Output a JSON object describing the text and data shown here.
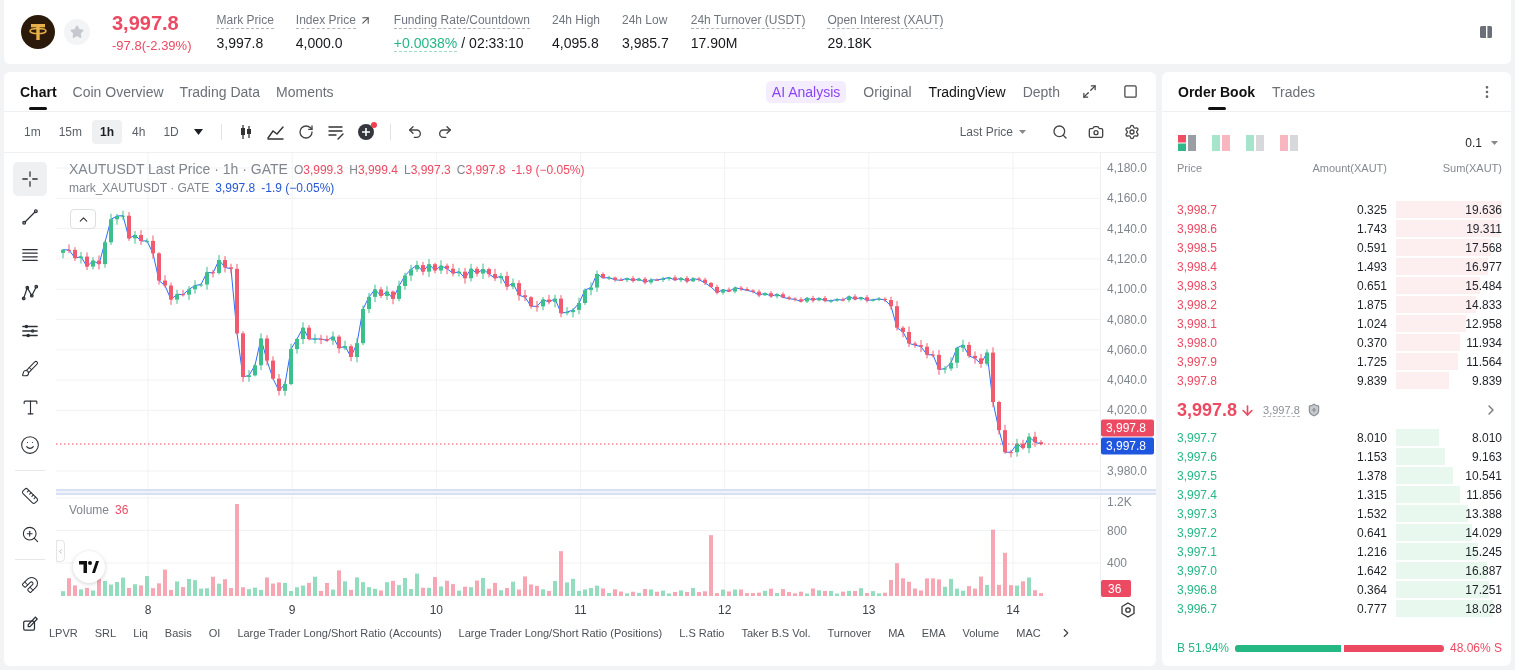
{
  "header": {
    "price": "3,997.8",
    "change": "-97.8(-2.39%)",
    "falling": true,
    "starred": false,
    "stats": [
      {
        "label": "Mark Price",
        "value": "3,997.8",
        "dotted": true,
        "link": false,
        "positive": false
      },
      {
        "label": "Index Price",
        "value": "4,000.0",
        "dotted": true,
        "link": true,
        "positive": false
      },
      {
        "label": "Funding Rate/Countdown",
        "value": "+0.0038%",
        "extra": "/ 02:33:10",
        "dotted": true,
        "link": false,
        "positive": true
      },
      {
        "label": "24h High",
        "value": "4,095.8",
        "dotted": false,
        "link": false,
        "positive": false
      },
      {
        "label": "24h Low",
        "value": "3,985.7",
        "dotted": false,
        "link": false,
        "positive": false
      },
      {
        "label": "24h Turnover (USDT)",
        "value": "17.90M",
        "dotted": true,
        "link": false,
        "positive": false
      },
      {
        "label": "Open Interest (XAUT)",
        "value": "29.18K",
        "dotted": true,
        "link": false,
        "positive": false
      }
    ]
  },
  "chart": {
    "tabs": [
      {
        "label": "Chart",
        "selected": true
      },
      {
        "label": "Coin Overview",
        "selected": false
      },
      {
        "label": "Trading Data",
        "selected": false
      },
      {
        "label": "Moments",
        "selected": false
      }
    ],
    "analysis": "AI Analysis",
    "views": [
      {
        "label": "Original",
        "selected": false
      },
      {
        "label": "TradingView",
        "selected": true
      },
      {
        "label": "Depth",
        "selected": false
      }
    ],
    "intervals": [
      {
        "label": "1m",
        "selected": false
      },
      {
        "label": "15m",
        "selected": false
      },
      {
        "label": "1h",
        "selected": true
      },
      {
        "label": "4h",
        "selected": false
      },
      {
        "label": "1D",
        "selected": false
      }
    ],
    "indicator_alert": true,
    "price_source": "Last Price",
    "tool_groups": [
      [
        {
          "kind": "crosshair",
          "selected": true
        },
        {
          "kind": "line",
          "selected": false
        },
        {
          "kind": "levels",
          "selected": false
        },
        {
          "kind": "pattern",
          "selected": false
        },
        {
          "kind": "lines",
          "selected": false
        },
        {
          "kind": "brush",
          "selected": false
        },
        {
          "kind": "text",
          "selected": false
        },
        {
          "kind": "emoji",
          "selected": false
        }
      ],
      [
        {
          "kind": "ruler",
          "selected": false
        },
        {
          "kind": "zoom",
          "selected": false
        }
      ],
      [
        {
          "kind": "magnet",
          "selected": false
        },
        {
          "kind": "pencil",
          "selected": false
        }
      ]
    ],
    "legend": {
      "title": "XAUTUSDT Last Price · 1h · GATE",
      "ohlc": [
        {
          "key": "O",
          "value": "3,999.3"
        },
        {
          "key": "H",
          "value": "3,999.4"
        },
        {
          "key": "L",
          "value": "3,997.3"
        },
        {
          "key": "C",
          "value": "3,997.8"
        }
      ],
      "change": "-1.9 (−0.05%)"
    },
    "mark_legend": {
      "title": "mark_XAUTUSDT · GATE",
      "value": "3,997.8",
      "change": "-1.9 (−0.05%)"
    },
    "price_axis": [
      "4,180.0",
      "4,160.0",
      "4,140.0",
      "4,120.0",
      "4,100.0",
      "4,080.0",
      "4,060.0",
      "4,040.0",
      "4,020.0",
      "3,980.0"
    ],
    "last_price_tag": "3,997.8",
    "mark_price_tag": "3,997.8",
    "volume": {
      "label": "Volume",
      "value": "36",
      "axis": [
        "1.2K",
        "800",
        "400"
      ],
      "tag": "36"
    },
    "time_axis": [
      "8",
      "9",
      "10",
      "11",
      "12",
      "13",
      "14"
    ],
    "indicators": [
      "LPVR",
      "SRL",
      "Liq",
      "Basis",
      "OI",
      "Large Trader Long/Short Ratio (Accounts)",
      "Large Trader Long/Short Ratio (Positions)",
      "L.S Ratio",
      "Taker B.S Vol.",
      "Turnover",
      "MA",
      "EMA",
      "Volume",
      "MAC"
    ]
  },
  "order_book": {
    "tabs": [
      {
        "label": "Order Book",
        "selected": true
      },
      {
        "label": "Trades",
        "selected": false
      }
    ],
    "layouts": [
      {
        "kind": "stacked",
        "selected": true
      },
      {
        "kind": "split",
        "selected": false
      },
      {
        "kind": "bids",
        "selected": false
      },
      {
        "kind": "asks",
        "selected": false
      }
    ],
    "precision": "0.1",
    "columns": [
      "Price",
      "Amount(XAUT)",
      "Sum(XAUT)"
    ],
    "asks": [
      {
        "price": "3,998.7",
        "amount": "0.325",
        "sum": "19.636"
      },
      {
        "price": "3,998.6",
        "amount": "1.743",
        "sum": "19.311"
      },
      {
        "price": "3,998.5",
        "amount": "0.591",
        "sum": "17.568"
      },
      {
        "price": "3,998.4",
        "amount": "1.493",
        "sum": "16.977"
      },
      {
        "price": "3,998.3",
        "amount": "0.651",
        "sum": "15.484"
      },
      {
        "price": "3,998.2",
        "amount": "1.875",
        "sum": "14.833"
      },
      {
        "price": "3,998.1",
        "amount": "1.024",
        "sum": "12.958"
      },
      {
        "price": "3,998.0",
        "amount": "0.370",
        "sum": "11.934"
      },
      {
        "price": "3,997.9",
        "amount": "1.725",
        "sum": "11.564"
      },
      {
        "price": "3,997.8",
        "amount": "9.839",
        "sum": "9.839"
      }
    ],
    "last": {
      "price": "3,997.8",
      "falling": true,
      "mark": "3,997.8"
    },
    "bids": [
      {
        "price": "3,997.7",
        "amount": "8.010",
        "sum": "8.010"
      },
      {
        "price": "3,997.6",
        "amount": "1.153",
        "sum": "9.163"
      },
      {
        "price": "3,997.5",
        "amount": "1.378",
        "sum": "10.541"
      },
      {
        "price": "3,997.4",
        "amount": "1.315",
        "sum": "11.856"
      },
      {
        "price": "3,997.3",
        "amount": "1.532",
        "sum": "13.388"
      },
      {
        "price": "3,997.2",
        "amount": "0.641",
        "sum": "14.029"
      },
      {
        "price": "3,997.1",
        "amount": "1.216",
        "sum": "15.245"
      },
      {
        "price": "3,997.0",
        "amount": "1.642",
        "sum": "16.887"
      },
      {
        "price": "3,996.8",
        "amount": "0.364",
        "sum": "17.251"
      },
      {
        "price": "3,996.7",
        "amount": "0.777",
        "sum": "18.028"
      }
    ],
    "ratio": {
      "buy": "B 51.94%",
      "sell": "48.06% S",
      "level": 0.5194
    }
  }
}
